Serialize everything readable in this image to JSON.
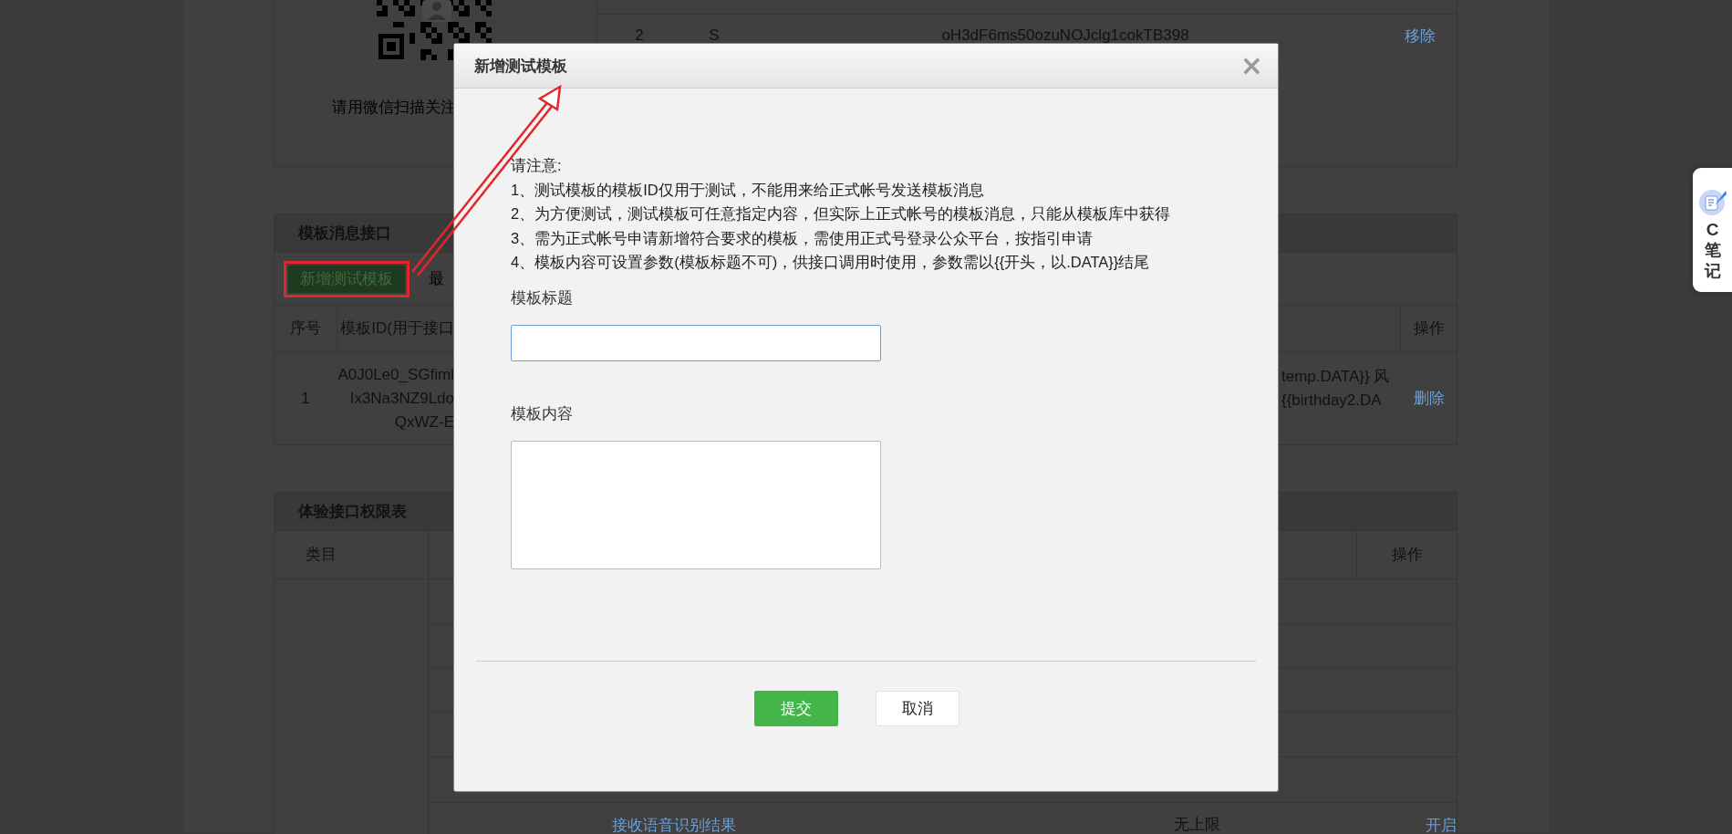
{
  "background_page": {
    "user_panel": {
      "qr_caption": "请用微信扫描关注",
      "row": {
        "index": "2",
        "column_2": "S",
        "openid": "oH3dF6ms50ozuNOJclg1cokTB398",
        "action": "移除"
      }
    },
    "template_section": {
      "title": "模板消息接口",
      "add_button": {
        "label": "新增测试模板",
        "highlighted": true
      },
      "note": "最",
      "columns": [
        "序号",
        "模板ID(用于接口",
        "操作"
      ],
      "rows": [
        {
          "index": "1",
          "template_id_lines": [
            "A0J0Le0_SGfiml",
            "Ix3Na3NZ9Ldo",
            "QxWZ-E"
          ],
          "content_lines": [
            "temp.DATA}} 风",
            "{{birthday2.DA"
          ],
          "action": "删除"
        }
      ]
    },
    "permissions_section": {
      "title": "体验接口权限表",
      "columns": [
        "类目",
        "操作"
      ],
      "rows": [
        {
          "name": "接收语音识别结果",
          "limit": "无上限",
          "action": "开启"
        }
      ]
    }
  },
  "dialog": {
    "title": "新增测试模板",
    "close": "×",
    "notes_heading": "请注意:",
    "notes": [
      "1、测试模板的模板ID仅用于测试，不能用来给正式帐号发送模板消息",
      "2、为方便测试，测试模板可任意指定内容，但实际上正式帐号的模板消息，只能从模板库中获得",
      "3、需为正式帐号申请新增符合要求的模板，需使用正式号登录公众平台，按指引申请",
      "4、模板内容可设置参数(模板标题不可)，供接口调用时使用，参数需以{{开头，以.DATA}}结尾"
    ],
    "fields": [
      {
        "label": "模板标题",
        "kind": "input",
        "focused": true
      },
      {
        "label": "模板内容",
        "kind": "textarea",
        "focused": false
      }
    ],
    "buttons": [
      {
        "label": "提交",
        "kind": "primary"
      },
      {
        "label": "取消",
        "kind": "secondary"
      }
    ]
  },
  "side_widget": {
    "letter": "C",
    "label": "笔记"
  }
}
